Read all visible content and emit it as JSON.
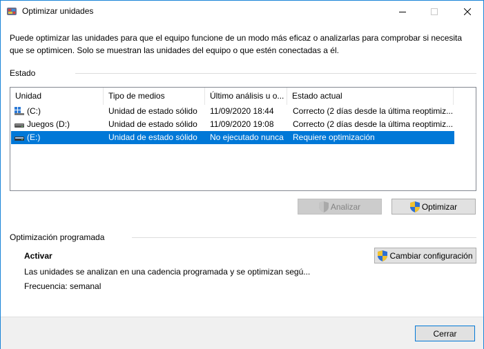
{
  "window": {
    "title": "Optimizar unidades"
  },
  "intro": "Puede optimizar las unidades para que el equipo funcione de un modo más eficaz o analizarlas para comprobar si necesita que se optimicen. Solo se muestran las unidades del equipo o que estén conectadas a él.",
  "estado": {
    "label": "Estado",
    "columns": [
      "Unidad",
      "Tipo de medios",
      "Último análisis u o...",
      "Estado actual"
    ],
    "rows": [
      {
        "unidad": "(C:)",
        "tipo": "Unidad de estado sólido",
        "ultimo": "11/09/2020 18:44",
        "estado": "Correcto (2 días desde la última reoptimiz...",
        "icon": "windows-drive-icon"
      },
      {
        "unidad": "Juegos (D:)",
        "tipo": "Unidad de estado sólido",
        "ultimo": "11/09/2020 19:08",
        "estado": "Correcto (2 días desde la última reoptimiz...",
        "icon": "drive-icon"
      },
      {
        "unidad": "(E:)",
        "tipo": "Unidad de estado sólido",
        "ultimo": "No ejecutado nunca",
        "estado": "Requiere optimización",
        "icon": "drive-icon",
        "selected": true
      }
    ]
  },
  "buttons": {
    "analizar": "Analizar",
    "optimizar": "Optimizar",
    "cambiar": "Cambiar configuración",
    "cerrar": "Cerrar"
  },
  "programada": {
    "label": "Optimización programada",
    "status": "Activar",
    "description": "Las unidades se analizan en una cadencia programada y se optimizan segú...",
    "frequency": "Frecuencia: semanal"
  },
  "colors": {
    "accent": "#0078d7",
    "border": "#1883d7"
  }
}
